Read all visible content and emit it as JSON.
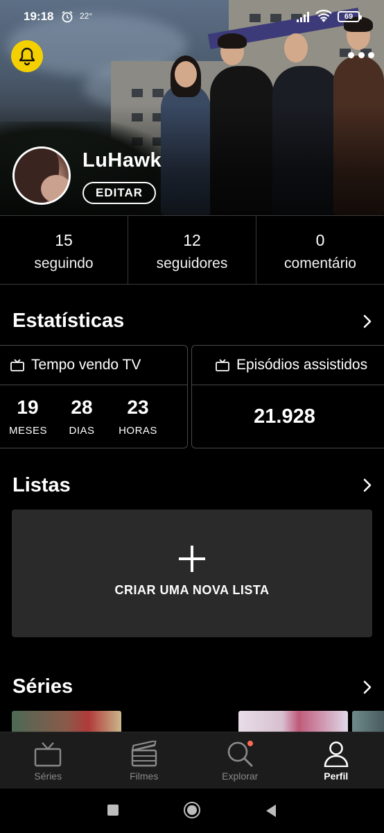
{
  "status_bar": {
    "time": "19:18",
    "temperature": "22°",
    "battery": "69"
  },
  "profile": {
    "username": "LuHawk",
    "edit_label": "EDITAR"
  },
  "stats": [
    {
      "value": "15",
      "label": "seguindo"
    },
    {
      "value": "12",
      "label": "seguidores"
    },
    {
      "value": "0",
      "label": "comentário"
    }
  ],
  "statistics": {
    "title": "Estatísticas",
    "tv_time": {
      "title": "Tempo vendo TV",
      "groups": [
        {
          "value": "19",
          "unit": "MESES"
        },
        {
          "value": "28",
          "unit": "DIAS"
        },
        {
          "value": "23",
          "unit": "HORAS"
        }
      ]
    },
    "episodes": {
      "title": "Episódios assistidos",
      "value": "21.928"
    }
  },
  "lists": {
    "title": "Listas",
    "create_label": "CRIAR UMA NOVA LISTA"
  },
  "series": {
    "title": "Séries"
  },
  "bottom_nav": [
    {
      "label": "Séries",
      "icon": "tv-icon"
    },
    {
      "label": "Filmes",
      "icon": "clapperboard-icon"
    },
    {
      "label": "Explorar",
      "icon": "search-icon"
    },
    {
      "label": "Perfil",
      "icon": "person-icon",
      "active": true
    }
  ],
  "colors": {
    "bell": "#f5d000",
    "card_bg": "#2a2a2a",
    "nav_bg": "#1c1c1c",
    "notification_dot": "#ff6a55"
  }
}
